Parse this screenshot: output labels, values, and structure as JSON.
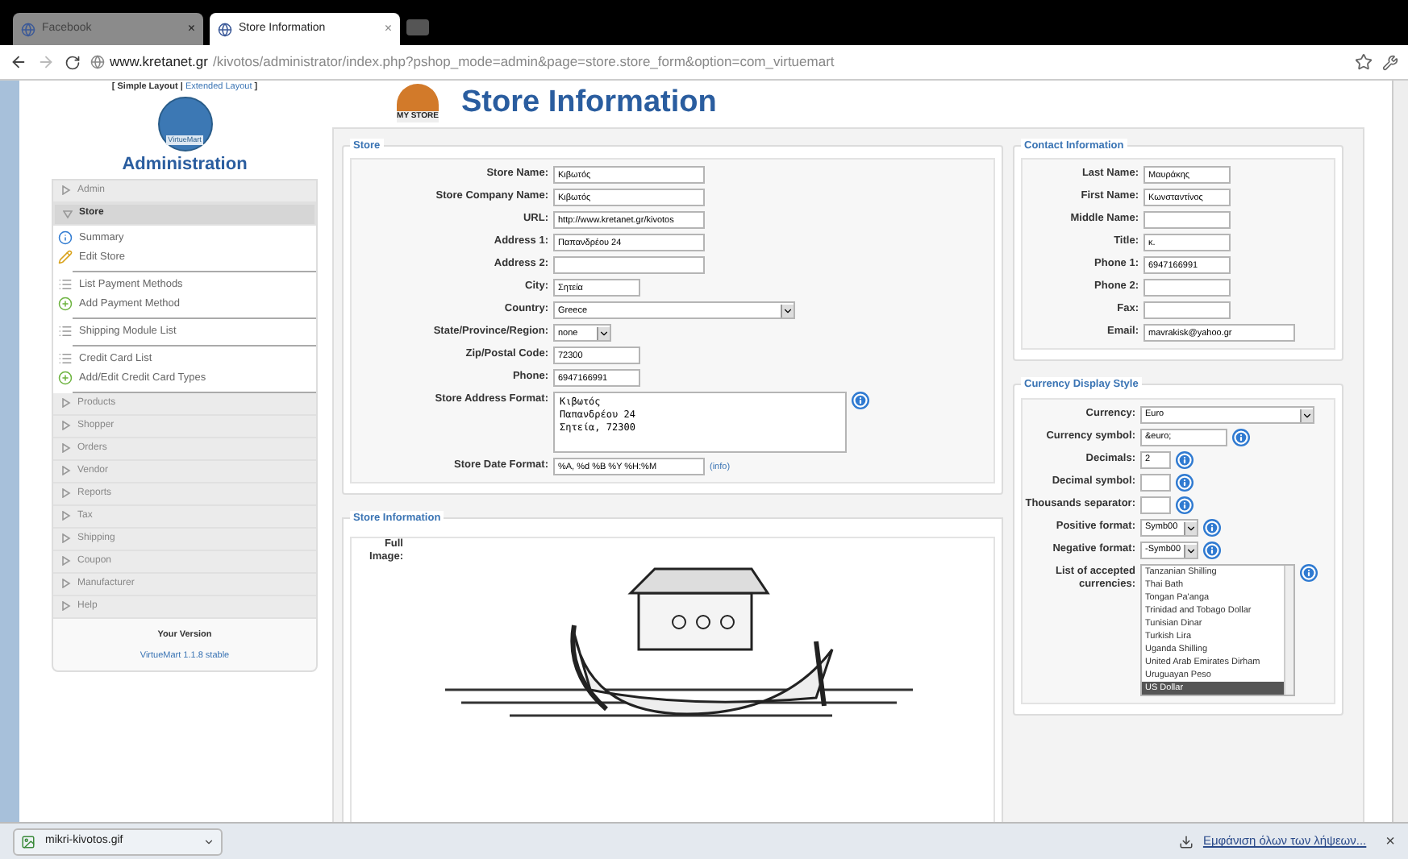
{
  "browser": {
    "tabs": [
      {
        "title": "Facebook",
        "selected": false,
        "close": "×"
      },
      {
        "title": "Store Information",
        "selected": true,
        "close": "×"
      }
    ],
    "url_host": "www.kretanet.gr",
    "url_path": "/kivotos/administrator/index.php?pshop_mode=admin&page=store.store_form&option=com_virtuemart"
  },
  "sidebar": {
    "layout_links": {
      "open": "[",
      "simple": "Simple Layout",
      "separator": "|",
      "extended": "Extended Layout",
      "close": "]"
    },
    "logo_label": "VirtueMart",
    "title": "Administration",
    "menu": [
      {
        "label": "Admin",
        "expanded": false,
        "selected": false
      },
      {
        "label": "Store",
        "expanded": true,
        "selected": true,
        "groups": [
          [
            {
              "label": "Summary",
              "kind": "info"
            },
            {
              "label": "Edit Store",
              "kind": "edit"
            }
          ],
          [
            {
              "label": "List Payment Methods",
              "kind": "list"
            },
            {
              "label": "Add Payment Method",
              "kind": "add"
            }
          ],
          [
            {
              "label": "Shipping Module List",
              "kind": "list"
            }
          ],
          [
            {
              "label": "Credit Card List",
              "kind": "list"
            },
            {
              "label": "Add/Edit Credit Card Types",
              "kind": "add"
            }
          ]
        ]
      },
      {
        "label": "Products",
        "expanded": false,
        "selected": false
      },
      {
        "label": "Shopper",
        "expanded": false,
        "selected": false
      },
      {
        "label": "Orders",
        "expanded": false,
        "selected": false
      },
      {
        "label": "Vendor",
        "expanded": false,
        "selected": false
      },
      {
        "label": "Reports",
        "expanded": false,
        "selected": false
      },
      {
        "label": "Tax",
        "expanded": false,
        "selected": false
      },
      {
        "label": "Shipping",
        "expanded": false,
        "selected": false
      },
      {
        "label": "Coupon",
        "expanded": false,
        "selected": false
      },
      {
        "label": "Manufacturer",
        "expanded": false,
        "selected": false
      },
      {
        "label": "Help",
        "expanded": false,
        "selected": false
      }
    ],
    "version_label": "Your Version",
    "version": "VirtueMart 1.1.8 stable"
  },
  "main": {
    "logo_text": "MY STORE",
    "title": "Store Information",
    "store": {
      "legend": "Store",
      "fields": [
        {
          "label": "Store Name:",
          "kind": "text",
          "value": "Κιβωτός"
        },
        {
          "label": "Store Company Name:",
          "kind": "text",
          "value": "Κιβωτός"
        },
        {
          "label": "URL:",
          "kind": "text",
          "value": "http://www.kretanet.gr/kivotos"
        },
        {
          "label": "Address 1:",
          "kind": "text",
          "value": "Παπανδρέου 24"
        },
        {
          "label": "Address 2:",
          "kind": "text"
        },
        {
          "label": "City:",
          "kind": "short",
          "value": "Σητεία"
        },
        {
          "label": "Country:",
          "kind": "select",
          "value": "Greece"
        },
        {
          "label": "State/Province/Region:",
          "kind": "select_small",
          "value": "none"
        },
        {
          "label": "Zip/Postal Code:",
          "kind": "short",
          "value": "72300"
        },
        {
          "label": "Phone:",
          "kind": "short",
          "value": "6947166991"
        },
        {
          "label": "Store Address Format:",
          "kind": "textarea",
          "help": true,
          "value": "Κιβωτός\nΠαπανδρέου 24\nΣητεία, 72300"
        },
        {
          "label": "Store Date Format:",
          "kind": "text",
          "value": "%A, %d %B %Y %H:%M",
          "link": "(info)"
        }
      ]
    },
    "contact": {
      "legend": "Contact Information",
      "fields": [
        {
          "label": "Last Name:",
          "kind": "short",
          "value": "Μαυράκης"
        },
        {
          "label": "First Name:",
          "kind": "short",
          "value": "Κωνσταντίνος"
        },
        {
          "label": "Middle Name:",
          "kind": "short"
        },
        {
          "label": "Title:",
          "kind": "short",
          "value": "κ."
        },
        {
          "label": "Phone 1:",
          "kind": "short",
          "value": "6947166991"
        },
        {
          "label": "Phone 2:",
          "kind": "short"
        },
        {
          "label": "Fax:",
          "kind": "short"
        },
        {
          "label": "Email:",
          "kind": "text",
          "value": "mavrakisk@yahoo.gr"
        }
      ]
    },
    "currency": {
      "legend": "Currency Display Style",
      "fields": [
        {
          "label": "Currency:",
          "kind": "select",
          "value": "Euro"
        },
        {
          "label": "Currency symbol:",
          "kind": "short",
          "value": "&euro;",
          "help": true
        },
        {
          "label": "Decimals:",
          "kind": "tiny",
          "value": "2",
          "help": true
        },
        {
          "label": "Decimal symbol:",
          "kind": "tiny",
          "help": true
        },
        {
          "label": "Thousands separator:",
          "kind": "tiny",
          "help": true
        },
        {
          "label": "Positive format:",
          "kind": "select_small",
          "value": "Symb00",
          "help": true
        },
        {
          "label": "Negative format:",
          "kind": "select_small",
          "value": "-Symb00",
          "help": true
        },
        {
          "label": "List of accepted currencies:",
          "kind": "listbox",
          "help": true,
          "options": [
            {
              "label": "Tanzanian Shilling",
              "selected": false
            },
            {
              "label": "Thai Bath",
              "selected": false
            },
            {
              "label": "Tongan Pa'anga",
              "selected": false
            },
            {
              "label": "Trinidad and Tobago Dollar",
              "selected": false
            },
            {
              "label": "Tunisian Dinar",
              "selected": false
            },
            {
              "label": "Turkish Lira",
              "selected": false
            },
            {
              "label": "Uganda Shilling",
              "selected": false
            },
            {
              "label": "United Arab Emirates Dirham",
              "selected": false
            },
            {
              "label": "Uruguayan Peso",
              "selected": false
            },
            {
              "label": "US Dollar",
              "selected": true
            }
          ]
        }
      ]
    },
    "store_info": {
      "legend": "Store Information",
      "image_label": "Full Image:"
    }
  },
  "downloads": {
    "file": "mikri-kivotos.gif",
    "show_all": "Εμφάνιση όλων των λήψεων...",
    "close": "×"
  }
}
